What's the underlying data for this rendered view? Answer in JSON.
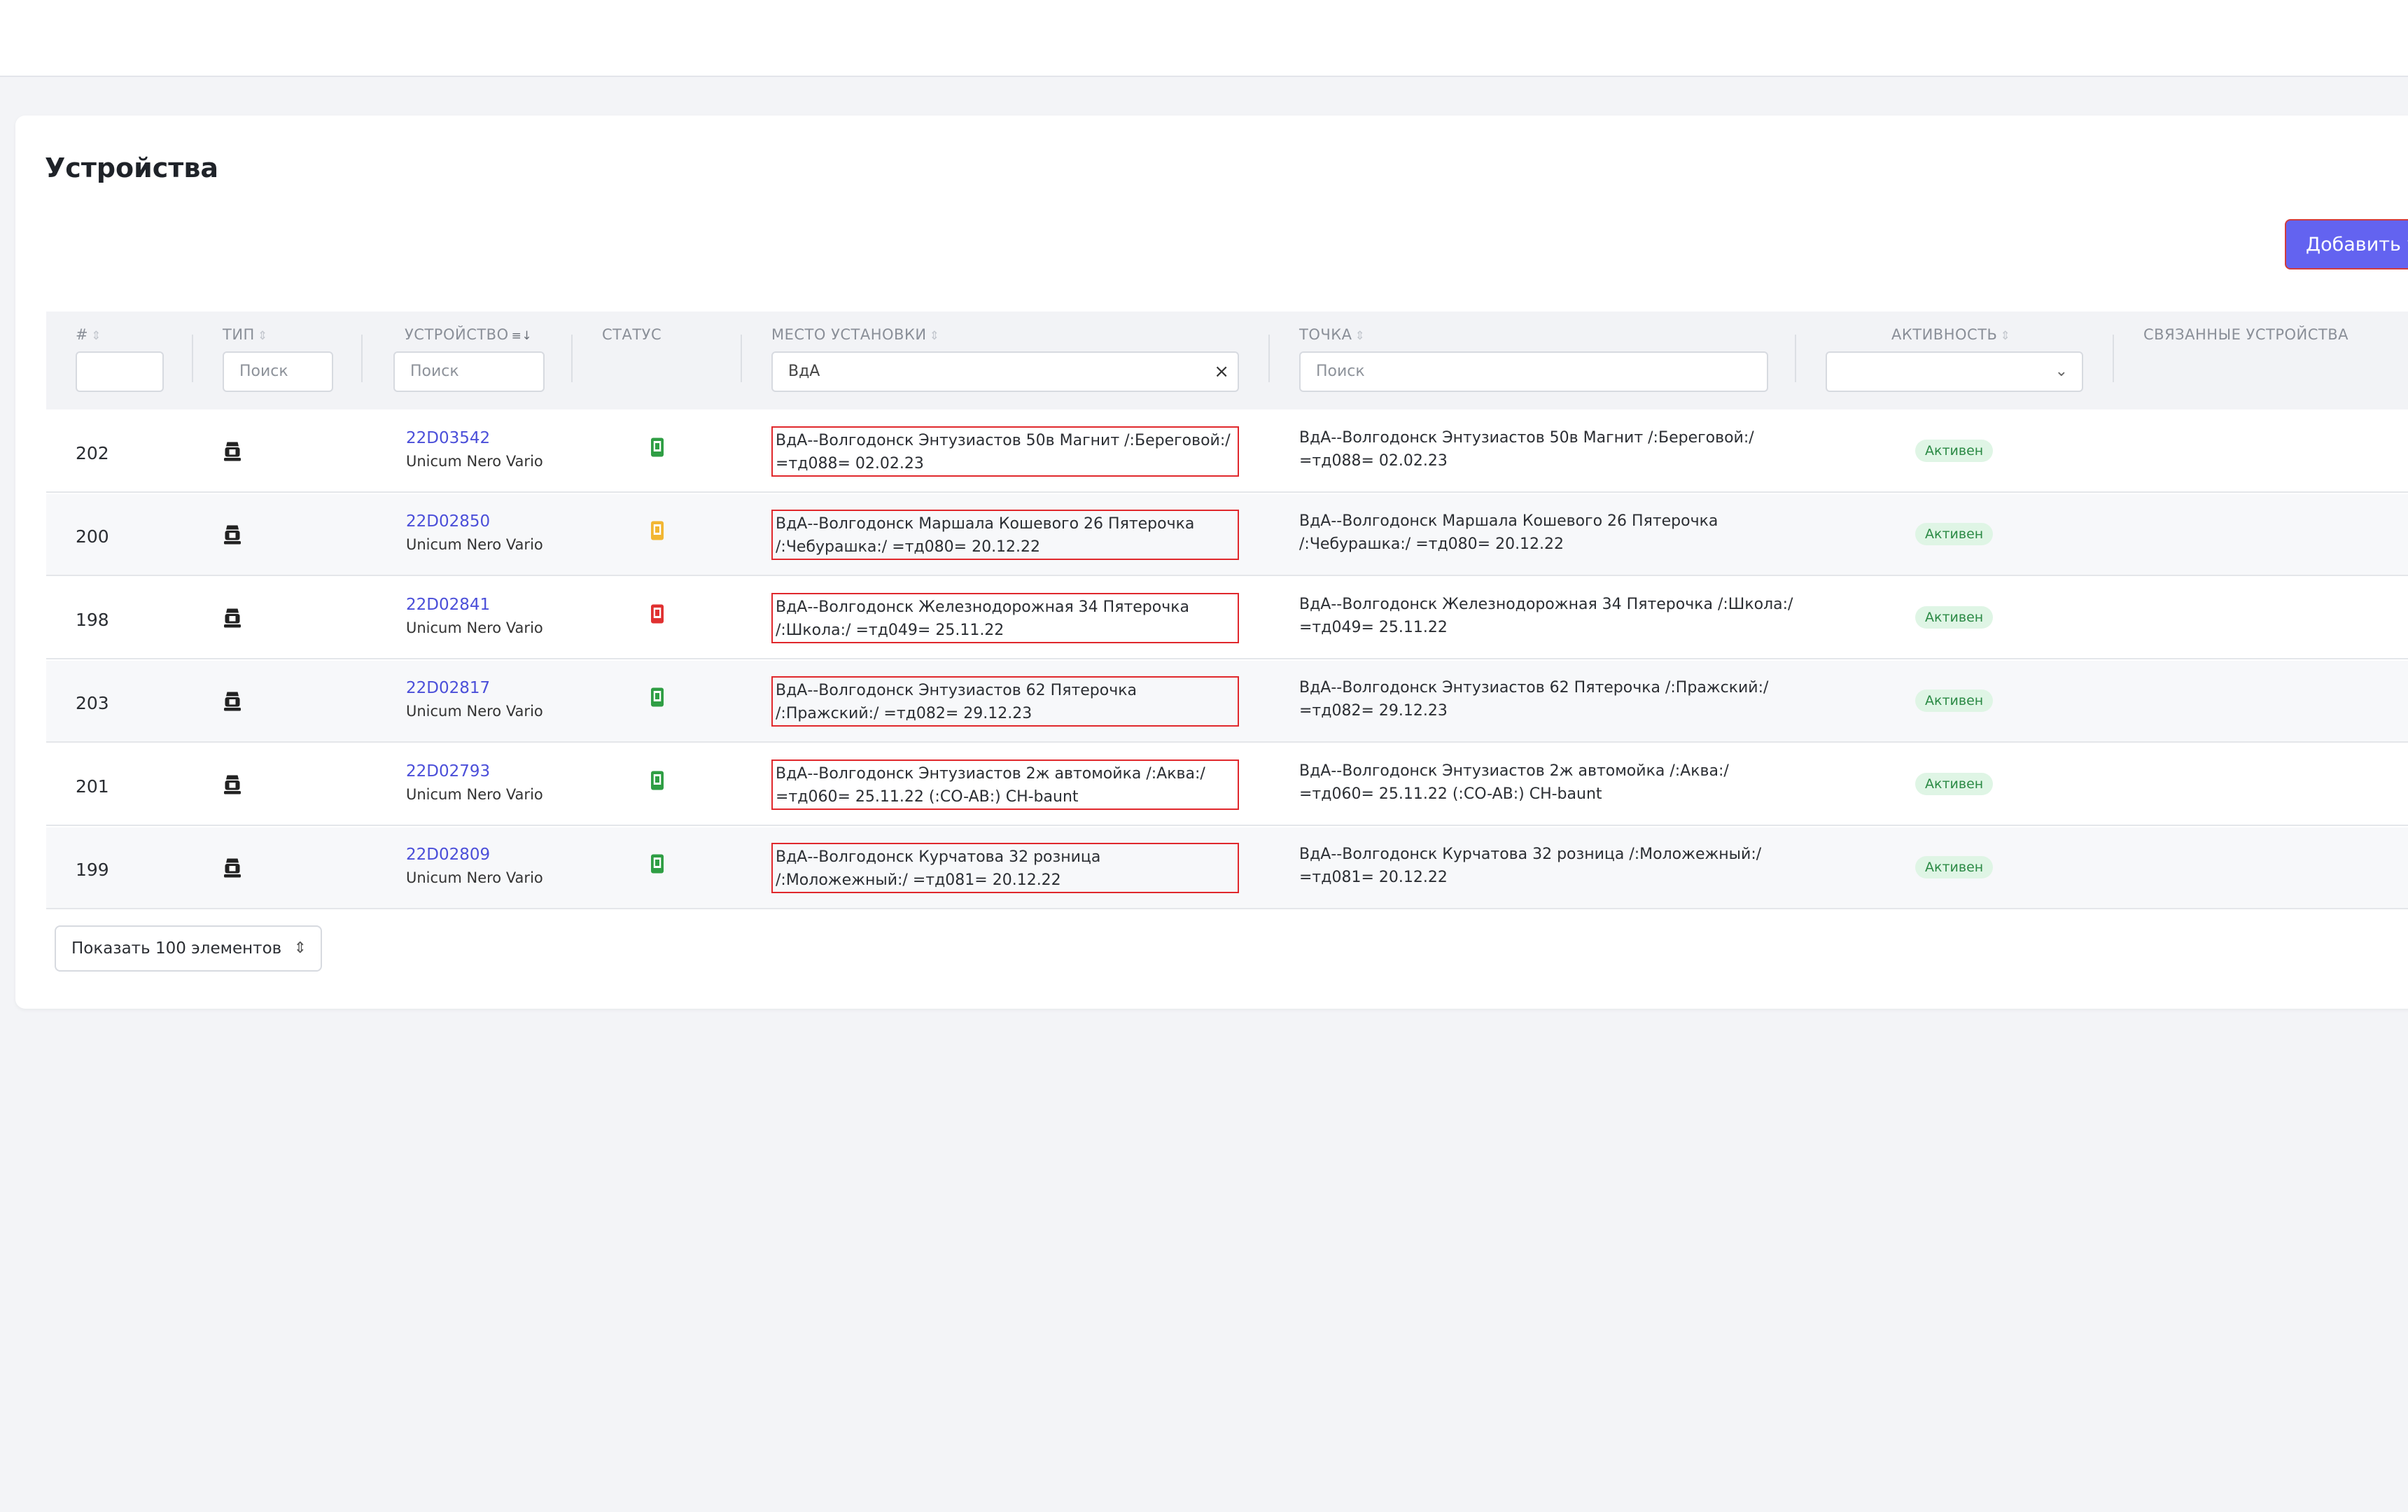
{
  "page": {
    "title": "Устройства",
    "add_button": "Добавить у"
  },
  "columns": {
    "num": "#",
    "type": "ТИП",
    "device": "УСТРОЙСТВО",
    "status": "СТАТУС",
    "place": "МЕСТО УСТАНОВКИ",
    "point": "ТОЧКА",
    "activity": "АКТИВНОСТЬ",
    "linked": "СВЯЗАННЫЕ УСТРОЙСТВА"
  },
  "filters": {
    "type_placeholder": "Поиск",
    "device_placeholder": "Поиск",
    "place_value": "ВдА",
    "point_placeholder": "Поиск",
    "activity_value": ""
  },
  "colors": {
    "accent": "#6363f0",
    "link": "#4b4fd9",
    "status_ok": "#2f9e44",
    "status_warn": "#f2b632",
    "status_err": "#e03131",
    "badge_bg": "#dff5e5",
    "badge_text": "#2b8a45"
  },
  "rows": [
    {
      "id": "202",
      "type_icon": "coffee-machine-icon",
      "device_id": "22D03542",
      "model": "Unicum Nero Vario",
      "status": "ok",
      "place": "ВдА--Волгодонск Энтузиастов 50в Магнит /:Береговой:/ =тд088= 02.02.23",
      "point": "ВдА--Волгодонск Энтузиастов 50в Магнит /:Береговой:/ =тд088= 02.02.23",
      "activity": "Активен"
    },
    {
      "id": "200",
      "type_icon": "coffee-machine-icon",
      "device_id": "22D02850",
      "model": "Unicum Nero Vario",
      "status": "warn",
      "place": "ВдА--Волгодонск Маршала Кошевого 26 Пятерочка /:Чебурашка:/ =тд080= 20.12.22",
      "point": "ВдА--Волгодонск Маршала Кошевого 26 Пятерочка /:Чебурашка:/ =тд080= 20.12.22",
      "activity": "Активен"
    },
    {
      "id": "198",
      "type_icon": "coffee-machine-icon",
      "device_id": "22D02841",
      "model": "Unicum Nero Vario",
      "status": "err",
      "place": "ВдА--Волгодонск Железнодорожная 34 Пятерочка /:Школа:/ =тд049= 25.11.22",
      "point": "ВдА--Волгодонск Железнодорожная 34 Пятерочка /:Школа:/ =тд049= 25.11.22",
      "activity": "Активен"
    },
    {
      "id": "203",
      "type_icon": "coffee-machine-icon",
      "device_id": "22D02817",
      "model": "Unicum Nero Vario",
      "status": "ok",
      "place": "ВдА--Волгодонск Энтузиастов 62 Пятерочка /:Пражский:/ =тд082= 29.12.23",
      "point": "ВдА--Волгодонск Энтузиастов 62 Пятерочка /:Пражский:/ =тд082= 29.12.23",
      "activity": "Активен"
    },
    {
      "id": "201",
      "type_icon": "coffee-machine-icon",
      "device_id": "22D02793",
      "model": "Unicum Nero Vario",
      "status": "ok",
      "place": "ВдА--Волгодонск Энтузиастов 2ж автомойка /:Аква:/ =тд060= 25.11.22 (:CO-AB:) CH-baunt",
      "point": "ВдА--Волгодонск Энтузиастов 2ж автомойка /:Аква:/ =тд060= 25.11.22 (:CO-AB:) CH-baunt",
      "activity": "Активен"
    },
    {
      "id": "199",
      "type_icon": "coffee-machine-icon",
      "device_id": "22D02809",
      "model": "Unicum Nero Vario",
      "status": "ok",
      "place": "ВдА--Волгодонск Курчатова 32 розница /:Моложежный:/ =тд081= 20.12.22",
      "point": "ВдА--Волгодонск Курчатова 32 розница /:Моложежный:/ =тд081= 20.12.22",
      "activity": "Активен"
    }
  ],
  "pager": {
    "label": "Показать 100 элементов"
  }
}
